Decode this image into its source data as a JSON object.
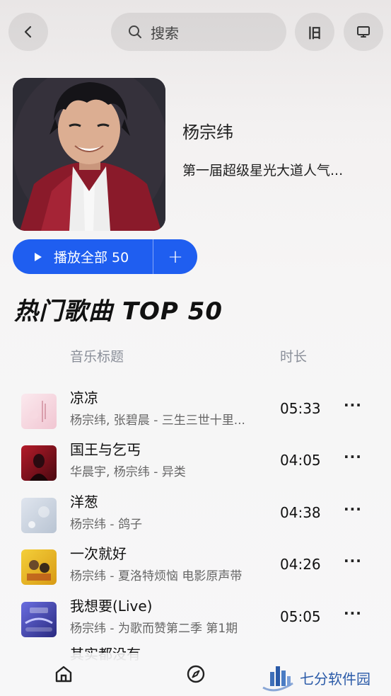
{
  "header": {
    "search_placeholder": "搜索",
    "history_label": "旧",
    "back_icon": "chevron-left-icon",
    "desktop_icon": "desktop-icon"
  },
  "artist": {
    "name": "杨宗纬",
    "description": "第一届超级星光大道人气..."
  },
  "actions": {
    "play_all_label": "播放全部 50",
    "add_label": "+"
  },
  "section": {
    "title": "热门歌曲 TOP 50",
    "col_title": "音乐标题",
    "col_duration": "时长"
  },
  "songs": [
    {
      "title": "凉凉",
      "sub": "杨宗纬, 张碧晨 - 三生三世十里...",
      "duration": "05:33",
      "more": "···",
      "thumb_color": "#f4d4dc"
    },
    {
      "title": "国王与乞丐",
      "sub": "华晨宇, 杨宗纬 - 异类",
      "duration": "04:05",
      "more": "···",
      "thumb_color": "#8c1420"
    },
    {
      "title": "洋葱",
      "sub": "杨宗纬 - 鸽子",
      "duration": "04:38",
      "more": "···",
      "thumb_color": "#c9d2de"
    },
    {
      "title": "一次就好",
      "sub": "杨宗纬 - 夏洛特烦恼 电影原声带",
      "duration": "04:26",
      "more": "···",
      "thumb_color": "#e8b824"
    },
    {
      "title": "我想要(Live)",
      "sub": "杨宗纬 - 为歌而赞第二季 第1期",
      "duration": "05:05",
      "more": "···",
      "thumb_color": "#4a4fb8"
    }
  ],
  "partial_row": "其实都没有",
  "bottom_nav": {
    "home_icon": "home-icon",
    "explore_icon": "compass-icon"
  },
  "watermark": "七分软件园"
}
